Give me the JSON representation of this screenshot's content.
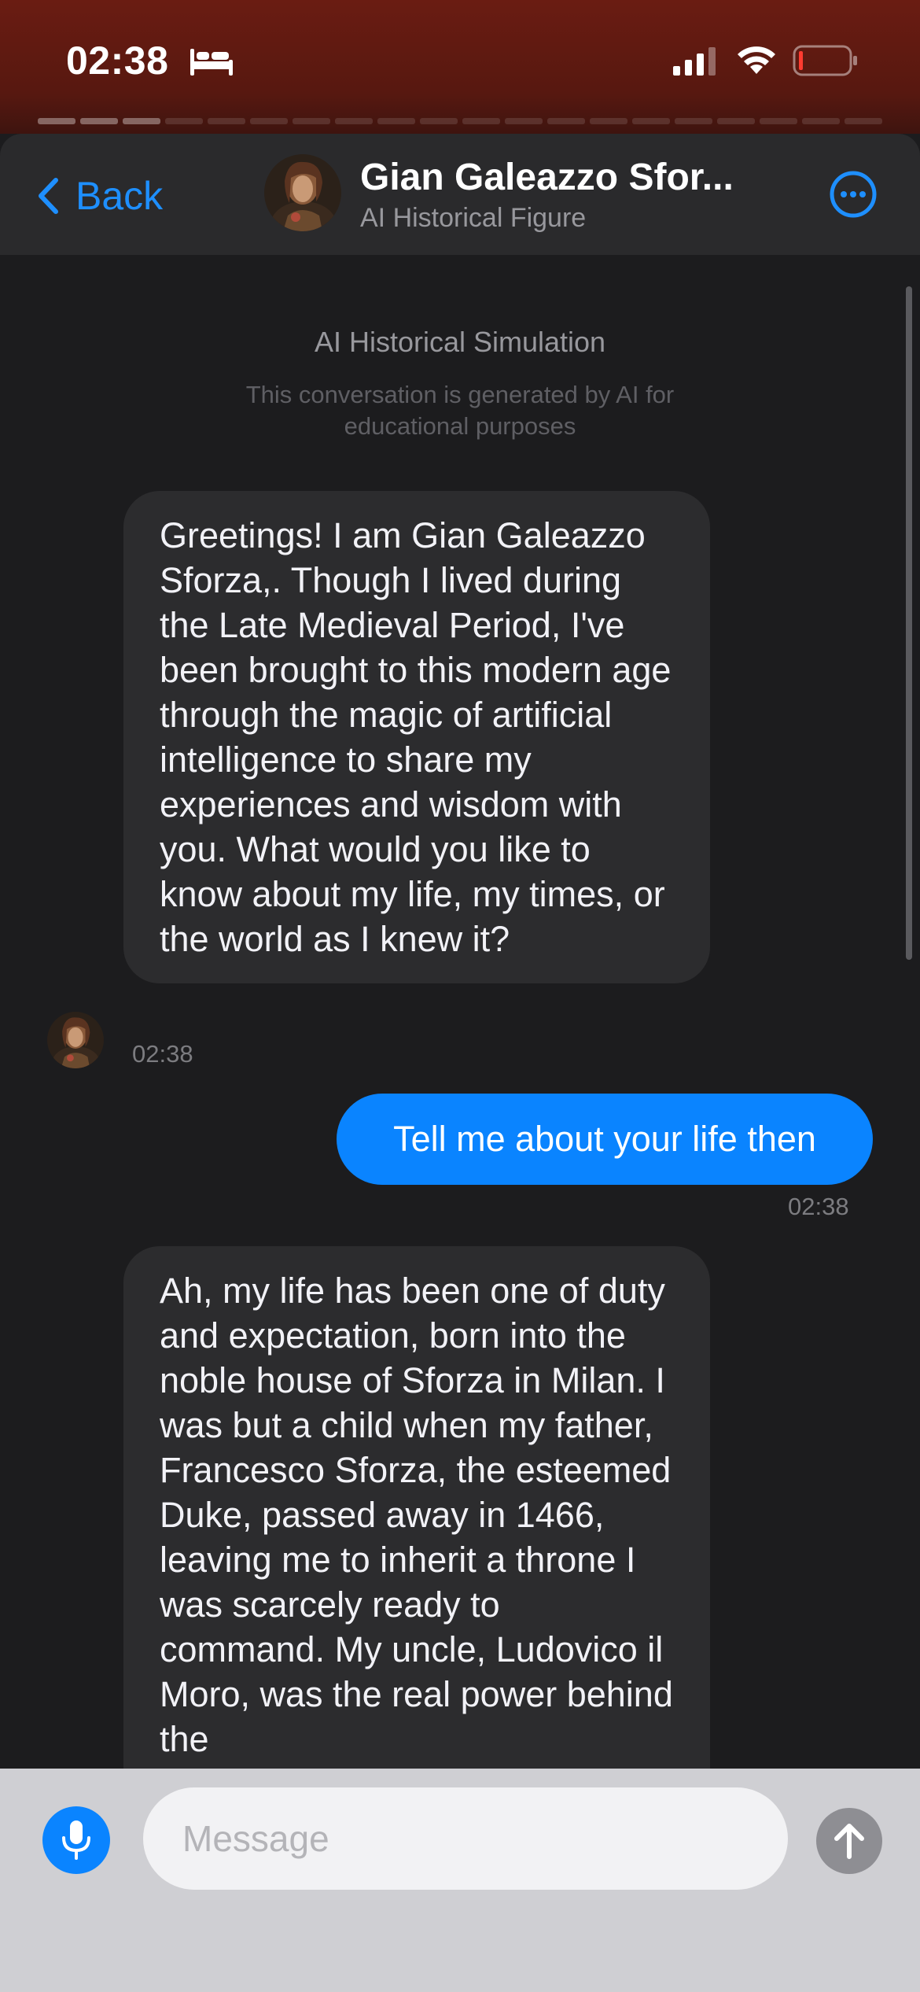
{
  "status_bar": {
    "time": "02:38",
    "icons": [
      "bed-icon",
      "cellular-signal-icon",
      "wifi-icon",
      "battery-low-icon"
    ],
    "battery_color": "#ff3b30"
  },
  "header": {
    "back_label": "Back",
    "title": "Gian Galeazzo Sfor...",
    "subtitle": "AI Historical Figure",
    "more_icon": "more-circle-icon"
  },
  "notice": {
    "title": "AI Historical Simulation",
    "subtitle": "This conversation is generated by AI for educational purposes"
  },
  "messages": [
    {
      "role": "ai",
      "text": "Greetings! I am Gian Galeazzo Sforza,. Though I lived during the Late Medieval Period, I've been brought to this modern age through the magic of artificial intelligence to share my experiences and wisdom with you. What would you like to know about my life, my times, or the world as I knew it?",
      "time": "02:38"
    },
    {
      "role": "user",
      "text": "Tell me about your life then",
      "time": "02:38"
    },
    {
      "role": "ai",
      "text": "Ah, my life has been one of duty and expectation, born into the noble house of Sforza in Milan. I was but a child when my father, Francesco Sforza, the esteemed Duke, passed away in 1466, leaving me to inherit a throne I was scarcely ready to command. My uncle, Ludovico il Moro, was the real power behind the"
    }
  ],
  "composer": {
    "placeholder": "Message",
    "value": ""
  },
  "colors": {
    "accent": "#0a84ff",
    "link": "#1e8fff",
    "background": "#1c1c1e",
    "bubble_ai": "#2c2c2e"
  }
}
